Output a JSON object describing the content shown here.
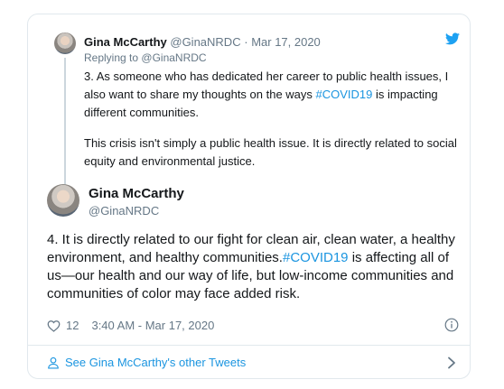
{
  "parent_tweet": {
    "author_name": "Gina McCarthy",
    "handle": "@GinaNRDC",
    "separator": "·",
    "date": "Mar 17, 2020",
    "reply_prefix": "Replying to",
    "reply_to": "@GinaNRDC",
    "para1_before": "3. As someone who has dedicated her career to public health issues, I also want to share my thoughts on the ways ",
    "para1_hashtag": "#COVID19",
    "para1_after": " is impacting different communities.",
    "para2": "This crisis isn't simply a public health issue. It is directly related to social equity and environmental justice."
  },
  "main_tweet": {
    "author_name": "Gina McCarthy",
    "handle": "@GinaNRDC",
    "text_before": "4. It is directly related to our fight for clean air, clean water, a healthy environment, and healthy communities.",
    "hashtag": "#COVID19",
    "text_after": " is affecting all of us—our health and our way of life, but low-income communities and communities of color may face added risk.",
    "like_count": "12",
    "timestamp": "3:40 AM - Mar 17, 2020"
  },
  "footer": {
    "link_text": "See Gina McCarthy's other Tweets"
  },
  "colors": {
    "link_blue": "#1b95e0",
    "muted_gray": "#657786",
    "border": "#e1e8ed",
    "twitter_blue": "#1da1f2"
  },
  "icons": {
    "logo": "twitter-bird-icon",
    "like": "heart-icon",
    "info": "info-icon",
    "profile": "person-icon",
    "next": "chevron-right-icon"
  }
}
